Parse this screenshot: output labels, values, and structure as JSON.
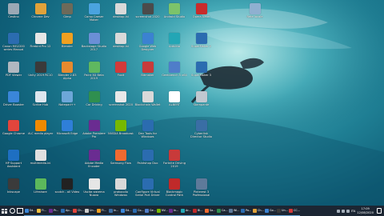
{
  "desktop": {
    "icons": [
      {
        "label": "Cestino",
        "color": "#9aa8b5",
        "col": 0,
        "row": 0
      },
      {
        "label": "Chrome Dev",
        "color": "#e0a23a",
        "col": 1,
        "row": 0
      },
      {
        "label": "Gimp",
        "color": "#6d6a5a",
        "col": 2,
        "row": 0
      },
      {
        "label": "Corso Caeser Maker",
        "color": "#4aa3df",
        "col": 3,
        "row": 0
      },
      {
        "label": "desktop.ini",
        "color": "#d9d9d9",
        "col": 4,
        "row": 0
      },
      {
        "label": "screenshot 2020",
        "color": "#4b4b4b",
        "col": 5,
        "row": 0
      },
      {
        "label": "Android Studio",
        "color": "#7cc36a",
        "col": 6,
        "row": 0
      },
      {
        "label": "Opera Neon",
        "color": "#c92b2b",
        "col": 7,
        "row": 0
      },
      {
        "label": "Rete locale",
        "color": "#8fb0d0",
        "col": 9,
        "row": 0
      },
      {
        "label": "Canon MG2200 series Manual",
        "color": "#2b6cb0",
        "col": 0,
        "row": 1
      },
      {
        "label": "Firebird Pro 12",
        "color": "#e6e6e6",
        "col": 1,
        "row": 1
      },
      {
        "label": "Blender",
        "color": "#f0a020",
        "col": 2,
        "row": 1
      },
      {
        "label": "Backstage Studio 2017",
        "color": "#6b8fd6",
        "col": 3,
        "row": 1
      },
      {
        "label": "desktop.ini",
        "color": "#d9d9d9",
        "col": 4,
        "row": 1
      },
      {
        "label": "Google Web Designer",
        "color": "#3b82d1",
        "col": 5,
        "row": 1
      },
      {
        "label": "Arduino",
        "color": "#23a6b5",
        "col": 6,
        "row": 1
      },
      {
        "label": "SuperMaker 2",
        "color": "#2b6cb0",
        "col": 7,
        "row": 1
      },
      {
        "label": "PDF Viewer",
        "color": "#b0b8c0",
        "col": 0,
        "row": 2
      },
      {
        "label": "Unity 2019 RC10",
        "color": "#3a3a3a",
        "col": 1,
        "row": 2
      },
      {
        "label": "Blender 2.83 Alpha",
        "color": "#e68a2e",
        "col": 2,
        "row": 2
      },
      {
        "label": "Paint 3D Beta 2019",
        "color": "#5fb85f",
        "col": 3,
        "row": 2
      },
      {
        "label": "Foxit",
        "color": "#d23a3a",
        "col": 4,
        "row": 2
      },
      {
        "label": "Bitmaker",
        "color": "#c83a3a",
        "col": 5,
        "row": 2
      },
      {
        "label": "Geekbench 5 x64",
        "color": "#4f7dc9",
        "col": 6,
        "row": 2
      },
      {
        "label": "SuperMaker 3",
        "color": "#2b6cb0",
        "col": 7,
        "row": 2
      },
      {
        "label": "Driver Booster",
        "color": "#3a86d8",
        "col": 0,
        "row": 3
      },
      {
        "label": "Scribe Hub",
        "color": "#dde6ee",
        "col": 1,
        "row": 3
      },
      {
        "label": "Notepad++",
        "color": "#6da7d8",
        "col": 2,
        "row": 3
      },
      {
        "label": "Car Driving",
        "color": "#2f8f4f",
        "col": 3,
        "row": 3
      },
      {
        "label": "screenshot 2020",
        "color": "#e8e8e8",
        "col": 4,
        "row": 3
      },
      {
        "label": "Blockchain Wallet",
        "color": "#d9d9d9",
        "col": 5,
        "row": 3
      },
      {
        "label": "ALBERT",
        "color": "#ffffff",
        "col": 6,
        "row": 3
      },
      {
        "label": "Stampante",
        "color": "#c0c8d0",
        "col": 7,
        "row": 3
      },
      {
        "label": "Google Chrome",
        "color": "#e2453c",
        "col": 0,
        "row": 4
      },
      {
        "label": "VLC media player",
        "color": "#f08a00",
        "col": 1,
        "row": 4
      },
      {
        "label": "Microsoft Edge",
        "color": "#2f7fd8",
        "col": 2,
        "row": 4
      },
      {
        "label": "Adobe Premiere Pro",
        "color": "#6a2c91",
        "col": 3,
        "row": 4
      },
      {
        "label": "NVIDIA Broadcast",
        "color": "#76b900",
        "col": 4,
        "row": 4
      },
      {
        "label": "Dev Tools for Windows",
        "color": "#2b6cb0",
        "col": 5,
        "row": 4
      },
      {
        "label": "Cyberlink Director Studio",
        "color": "#3a6ea5",
        "col": 7,
        "row": 4
      },
      {
        "label": "HP Support Assistant",
        "color": "#1e6fc2",
        "col": 0,
        "row": 5
      },
      {
        "label": "multimedia.ini",
        "color": "#e0e0e0",
        "col": 1,
        "row": 5
      },
      {
        "label": "Adobe Media Encoder",
        "color": "#6a2c91",
        "col": 3,
        "row": 5
      },
      {
        "label": "Samsung Flow",
        "color": "#f06a30",
        "col": 4,
        "row": 5
      },
      {
        "label": "Paintshop Duo",
        "color": "#2b6cb0",
        "col": 5,
        "row": 5
      },
      {
        "label": "Fortnite Driving 2019",
        "color": "#c83a3a",
        "col": 6,
        "row": 5
      },
      {
        "label": "Inkscape",
        "color": "#3b3b3b",
        "col": 0,
        "row": 6
      },
      {
        "label": "Lifeshare",
        "color": "#5cb85c",
        "col": 1,
        "row": 6
      },
      {
        "label": "scotch - all Video",
        "color": "#222222",
        "col": 2,
        "row": 6
      },
      {
        "label": "Uscita sistema Nuovo",
        "color": "#e6e6e6",
        "col": 3,
        "row": 6
      },
      {
        "label": "protocollo Windows",
        "color": "#d9d9d9",
        "col": 4,
        "row": 6
      },
      {
        "label": "Configure Virtual Serial Port Driver",
        "color": "#2b6cb0",
        "col": 5,
        "row": 6
      },
      {
        "label": "Blackmagic Control Path",
        "color": "#c02a2a",
        "col": 6,
        "row": 6
      },
      {
        "label": "Pinterest 3 Professional",
        "color": "#5e7a9a",
        "col": 7,
        "row": 6
      }
    ]
  },
  "taskbar": {
    "apps": [
      {
        "label": "Ed...",
        "color": "#3a86d8"
      },
      {
        "label": "Fi...",
        "color": "#f0c040"
      },
      {
        "label": "Pr...",
        "color": "#6a2c91"
      },
      {
        "label": "Ap...",
        "color": "#2b6cb0"
      },
      {
        "label": "Ch...",
        "color": "#e2453c"
      },
      {
        "label": "Un...",
        "color": "#cccccc"
      },
      {
        "label": "Fi...",
        "color": "#f0a020"
      },
      {
        "label": "In...",
        "color": "#3a6ea5"
      },
      {
        "label": "Ed...",
        "color": "#3a86d8"
      },
      {
        "label": "Co...",
        "color": "#2b6cb0"
      },
      {
        "label": "Ge...",
        "color": "#4f7dc9"
      },
      {
        "label": "NV...",
        "color": "#76b900"
      },
      {
        "label": "In...",
        "color": "#6a2c91"
      },
      {
        "label": "Ar...",
        "color": "#23a6b5"
      },
      {
        "label": "Bl...",
        "color": "#c02a2a"
      },
      {
        "label": "Sa...",
        "color": "#f06a30"
      },
      {
        "label": "Ca...",
        "color": "#2f8f4f"
      },
      {
        "label": "Wi...",
        "color": "#5e7a9a"
      },
      {
        "label": "Pa...",
        "color": "#2b6cb0"
      },
      {
        "label": "Ch...",
        "color": "#e0a23a"
      },
      {
        "label": "Go...",
        "color": "#3b82d1"
      },
      {
        "label": "Un...",
        "color": "#3a3a3a"
      },
      {
        "label": "CC...",
        "color": "#d23a3a"
      }
    ],
    "language": "ITA",
    "time": "17:09",
    "date": "12/08/2020"
  }
}
